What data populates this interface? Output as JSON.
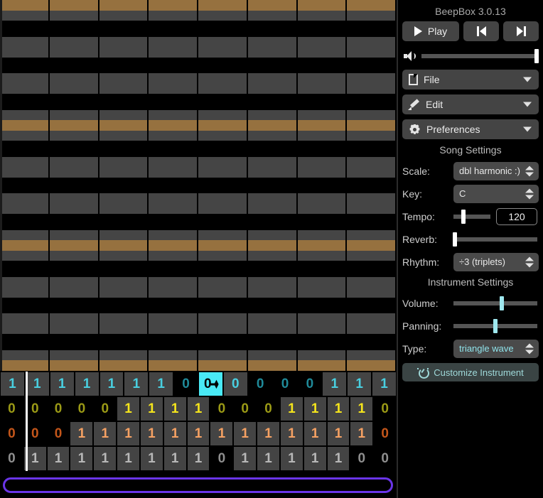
{
  "app": {
    "title": "BeepBox 3.0.13"
  },
  "toolbar": {
    "play_label": "Play",
    "play_icon": "play-triangle-icon",
    "prev_icon": "skip-previous-icon",
    "next_icon": "skip-next-icon",
    "volume_icon": "speaker-icon",
    "volume_value": 98
  },
  "menus": [
    {
      "label": "File",
      "icon": "file-icon",
      "name": "file-menu-button"
    },
    {
      "label": "Edit",
      "icon": "pencil-icon",
      "name": "edit-menu-button"
    },
    {
      "label": "Preferences",
      "icon": "gear-icon",
      "name": "preferences-menu-button"
    }
  ],
  "song_settings": {
    "title": "Song Settings",
    "scale": {
      "label": "Scale:",
      "value": "dbl harmonic :)"
    },
    "key": {
      "label": "Key:",
      "value": "C"
    },
    "tempo": {
      "label": "Tempo:",
      "value": "120",
      "slider_percent": 26
    },
    "reverb": {
      "label": "Reverb:",
      "slider_percent": 2
    },
    "rhythm": {
      "label": "Rhythm:",
      "value": "÷3 (triplets)"
    }
  },
  "instrument_settings": {
    "title": "Instrument Settings",
    "volume": {
      "label": "Volume:",
      "slider_percent": 58
    },
    "panning": {
      "label": "Panning:",
      "slider_percent": 50
    },
    "type": {
      "label": "Type:",
      "value": "triangle wave"
    },
    "customize_label": "Customize Instrument",
    "customize_icon": "knob-icon"
  },
  "colors": {
    "accent_cyan": "#49e9f5",
    "channel_0": "#49cfe0",
    "channel_1": "#f5e51c",
    "channel_2": "#f5a163",
    "channel_3": "#b8b8b8",
    "note_accent_brown": "#96713f",
    "note_row_gray": "#454545",
    "loop_purple": "#6a35e8",
    "button_gray": "#444444"
  },
  "note_editor": {
    "columns": 8,
    "row_types": [
      "accent",
      "filled",
      "empty",
      "filled",
      "filled",
      "empty",
      "filled",
      "filled",
      "empty",
      "filled",
      "accent",
      "filled",
      "empty",
      "filled",
      "filled",
      "empty",
      "filled",
      "filled",
      "empty",
      "filled",
      "accent",
      "filled",
      "empty",
      "filled",
      "filled",
      "empty",
      "filled",
      "filled",
      "empty",
      "filled",
      "accent"
    ]
  },
  "track_editor": {
    "playhead_column": 1,
    "selected": {
      "row": 0,
      "col": 8,
      "value": "0"
    },
    "channels": [
      {
        "name": "channel-0",
        "cells": [
          "1",
          "1",
          "1",
          "1",
          "1",
          "1",
          "1",
          "0",
          "0",
          "0",
          "0",
          "0",
          "0",
          "1",
          "1",
          "1"
        ],
        "on": [
          true,
          true,
          true,
          true,
          true,
          true,
          true,
          false,
          false,
          true,
          false,
          false,
          false,
          true,
          true,
          true
        ]
      },
      {
        "name": "channel-1",
        "cells": [
          "0",
          "0",
          "0",
          "0",
          "0",
          "1",
          "1",
          "1",
          "1",
          "0",
          "0",
          "0",
          "1",
          "1",
          "1",
          "1",
          "0"
        ],
        "on": [
          false,
          false,
          false,
          false,
          false,
          true,
          true,
          true,
          true,
          false,
          false,
          false,
          true,
          true,
          true,
          true,
          false
        ]
      },
      {
        "name": "channel-2",
        "cells": [
          "0",
          "0",
          "0",
          "1",
          "1",
          "1",
          "1",
          "1",
          "1",
          "1",
          "1",
          "1",
          "1",
          "1",
          "1",
          "1",
          "0"
        ],
        "on": [
          false,
          false,
          false,
          true,
          true,
          true,
          true,
          true,
          true,
          true,
          true,
          true,
          true,
          true,
          true,
          true,
          false
        ]
      },
      {
        "name": "channel-3",
        "cells": [
          "0",
          "1",
          "1",
          "1",
          "1",
          "1",
          "1",
          "1",
          "1",
          "0",
          "1",
          "1",
          "1",
          "1",
          "1",
          "0",
          "0"
        ],
        "on": [
          false,
          true,
          true,
          true,
          true,
          true,
          true,
          true,
          true,
          false,
          true,
          true,
          true,
          true,
          true,
          false,
          false
        ]
      }
    ]
  },
  "loop_bar": {
    "name": "loop-range-bar"
  }
}
